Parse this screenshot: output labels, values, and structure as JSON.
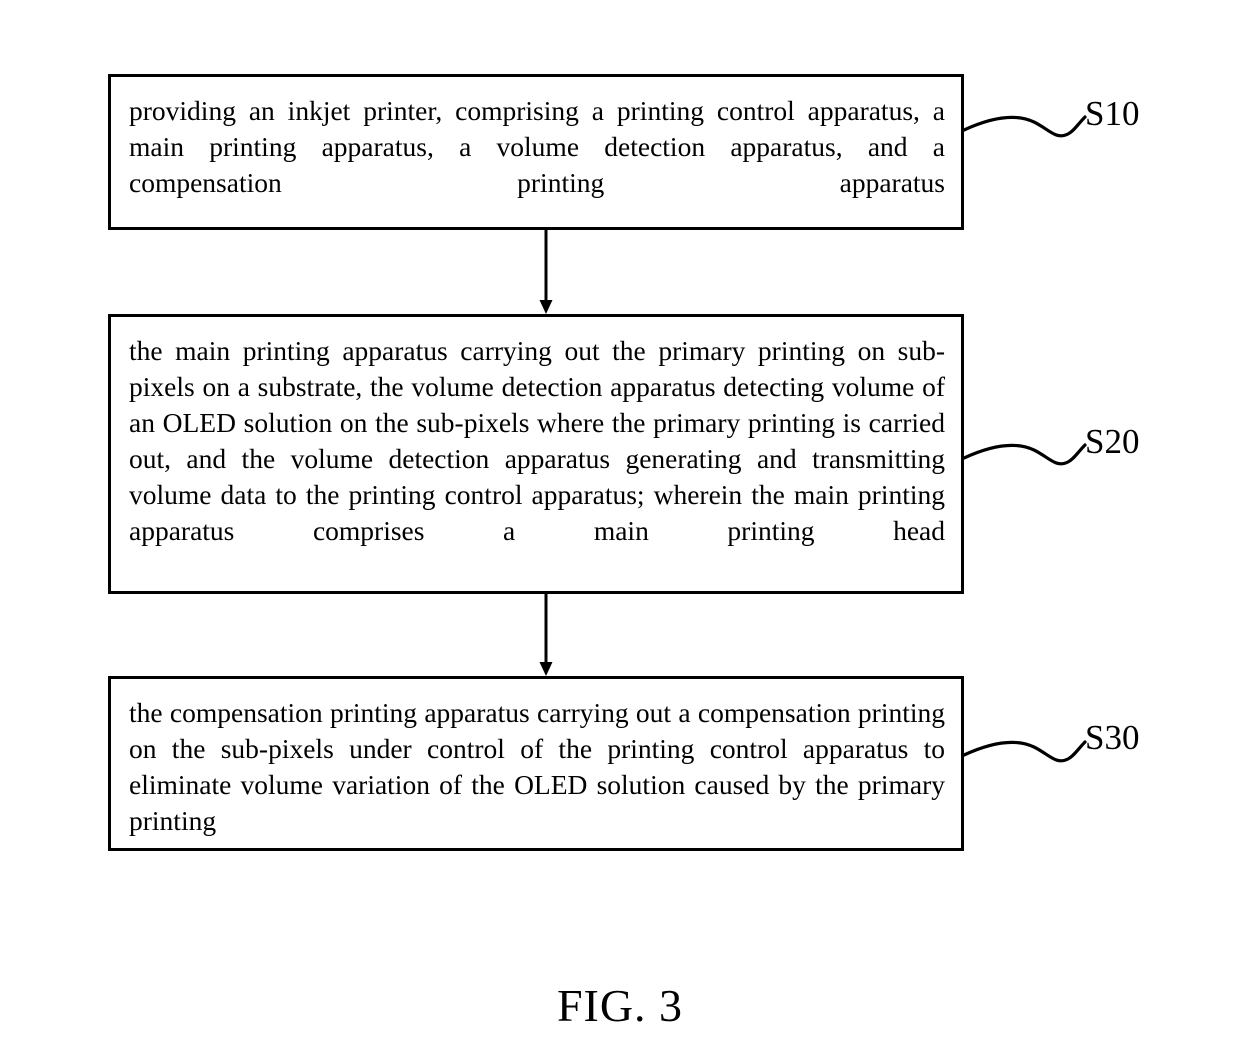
{
  "figure": {
    "caption": "FIG. 3",
    "type": "patent-flowchart",
    "background_color": "#ffffff",
    "line_color": "#000000"
  },
  "steps": [
    {
      "id": "S10",
      "label": "S10",
      "text": "providing an inkjet printer, comprising a printing control apparatus, a main printing apparatus, a volume detection apparatus, and a compensation printing apparatus"
    },
    {
      "id": "S20",
      "label": "S20",
      "text": "the main printing apparatus carrying out the primary printing on sub-pixels on a substrate, the volume detection apparatus detecting volume of an OLED solution on the sub-pixels where the primary printing is carried out, and the volume detection apparatus generating and transmitting volume data to the printing control apparatus; wherein the main printing apparatus comprises a main printing head"
    },
    {
      "id": "S30",
      "label": "S30",
      "text": "the compensation printing apparatus carrying out a compensation printing on the sub-pixels under control of the printing control apparatus to eliminate volume variation of the OLED solution caused by the primary printing"
    }
  ],
  "connectors": [
    {
      "name": "arrow-step1-to-step2",
      "from": "S10",
      "to": "S20",
      "direction": "down"
    },
    {
      "name": "arrow-step2-to-step3",
      "from": "S20",
      "to": "S30",
      "direction": "down"
    }
  ],
  "leaders": [
    {
      "name": "leader-s10",
      "for": "S10",
      "shape": "s-curve"
    },
    {
      "name": "leader-s20",
      "for": "S20",
      "shape": "s-curve"
    },
    {
      "name": "leader-s30",
      "for": "S30",
      "shape": "s-curve"
    }
  ]
}
